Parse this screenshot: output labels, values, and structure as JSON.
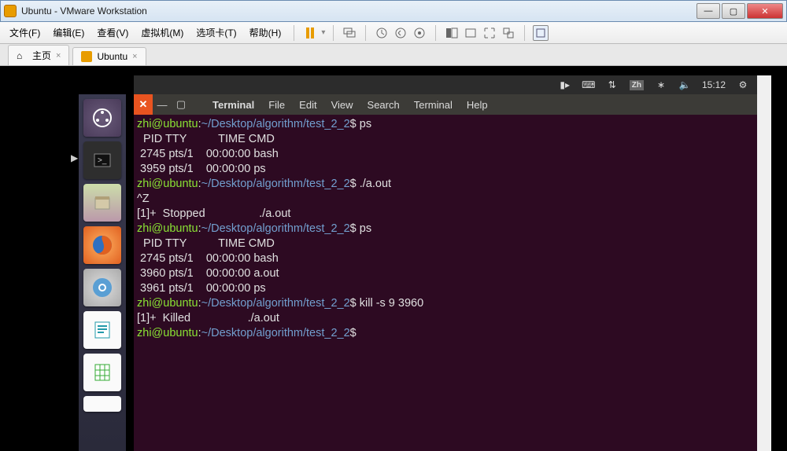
{
  "window": {
    "title": "Ubuntu - VMware Workstation"
  },
  "menubar": {
    "file": "文件(F)",
    "edit": "编辑(E)",
    "view": "查看(V)",
    "vm": "虚拟机(M)",
    "tabs": "选项卡(T)",
    "help": "帮助(H)"
  },
  "tabs": {
    "home": "主页",
    "vm": "Ubuntu"
  },
  "panel": {
    "time": "15:12",
    "ime": "Zh"
  },
  "terminal": {
    "title": "Terminal",
    "menus": [
      "File",
      "Edit",
      "View",
      "Search",
      "Terminal",
      "Help"
    ],
    "prompt_user": "zhi@ubuntu",
    "prompt_sep": ":",
    "prompt_path": "~/Desktop/algorithm/test_2_2",
    "prompt_sym": "$",
    "lines": [
      {
        "type": "prompt",
        "cmd": "ps"
      },
      {
        "type": "out",
        "text": "  PID TTY          TIME CMD"
      },
      {
        "type": "out",
        "text": " 2745 pts/1    00:00:00 bash"
      },
      {
        "type": "out",
        "text": " 3959 pts/1    00:00:00 ps"
      },
      {
        "type": "prompt",
        "cmd": "./a.out"
      },
      {
        "type": "out",
        "text": "^Z"
      },
      {
        "type": "out",
        "text": "[1]+  Stopped                 ./a.out"
      },
      {
        "type": "prompt",
        "cmd": "ps"
      },
      {
        "type": "out",
        "text": "  PID TTY          TIME CMD"
      },
      {
        "type": "out",
        "text": " 2745 pts/1    00:00:00 bash"
      },
      {
        "type": "out",
        "text": " 3960 pts/1    00:00:00 a.out"
      },
      {
        "type": "out",
        "text": " 3961 pts/1    00:00:00 ps"
      },
      {
        "type": "prompt",
        "cmd": "kill -s 9 3960"
      },
      {
        "type": "out",
        "text": "[1]+  Killed                  ./a.out"
      },
      {
        "type": "prompt",
        "cmd": ""
      }
    ]
  }
}
